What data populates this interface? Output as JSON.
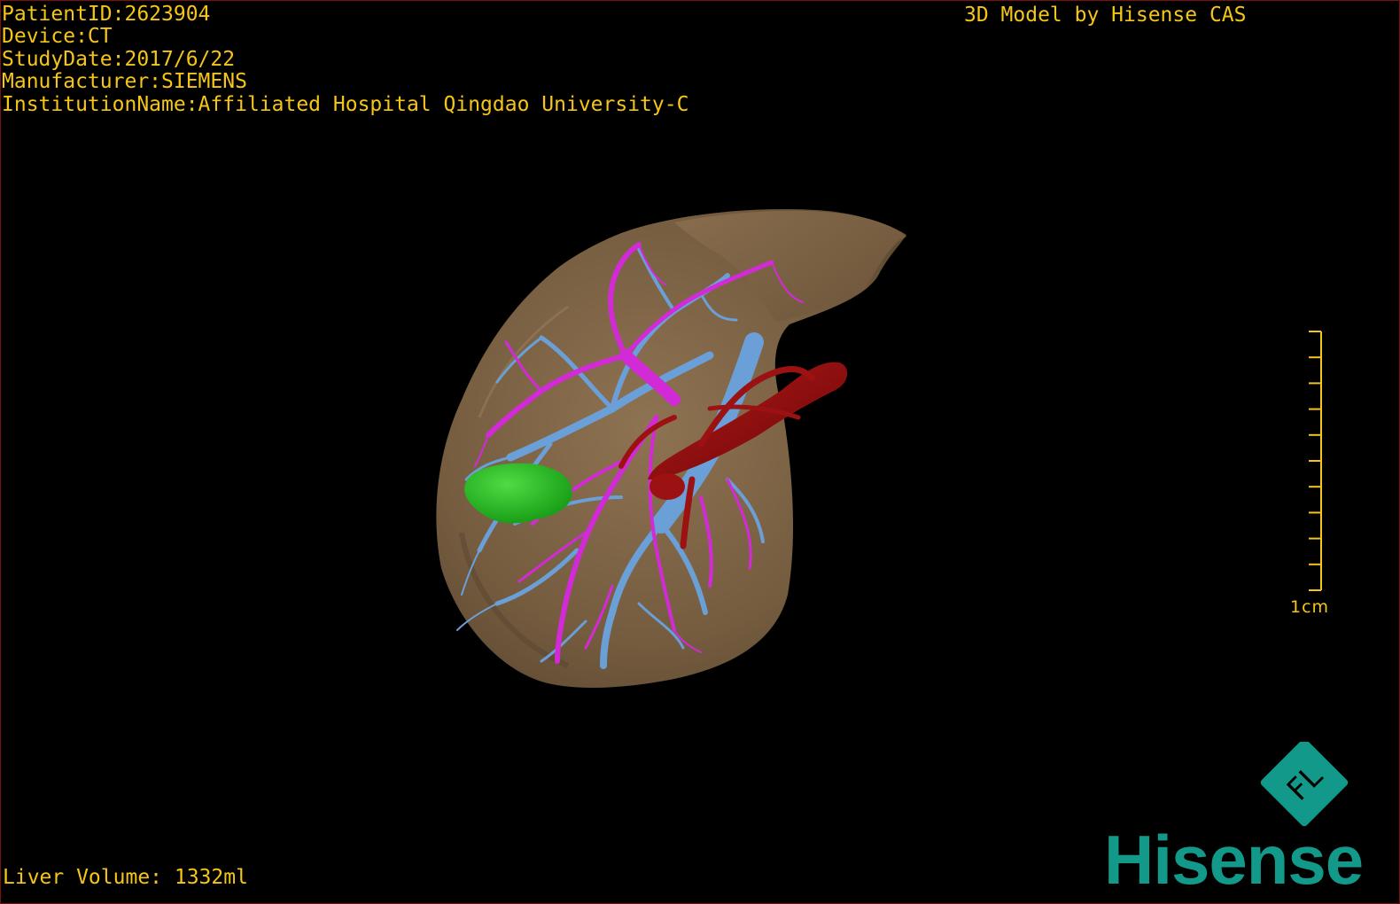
{
  "viewer": {
    "text_color": "#f5c518",
    "background_color": "#000000",
    "frame_color": "#7a1010"
  },
  "dicom_info": {
    "patient_id": "PatientID:2623904",
    "device": "Device:CT",
    "study_date": "StudyDate:2017/6/22",
    "manufacturer": "Manufacturer:SIEMENS",
    "institution": "InstitutionName:Affiliated Hospital Qingdao University-C"
  },
  "model_credit": "3D Model by Hisense CAS",
  "liver_volume": "Liver Volume: 1332ml",
  "scale_bar": {
    "label": "1cm",
    "color": "#f5c518"
  },
  "anatomy": {
    "liver": {
      "color": "#7d6446",
      "icon": "liver-surface"
    },
    "portal_vein": {
      "color": "#d22ad6",
      "icon": "portal-vein-tree"
    },
    "hepatic_vein": {
      "color": "#6a9fd8",
      "icon": "hepatic-vein-tree"
    },
    "artery": {
      "color": "#8a0c0c",
      "icon": "hepatic-artery"
    },
    "lesion": {
      "color": "#22b61e",
      "icon": "tumor-lesion"
    }
  },
  "brand": {
    "name": "Hisense",
    "badge_letters": "FL",
    "color": "#12998a"
  }
}
